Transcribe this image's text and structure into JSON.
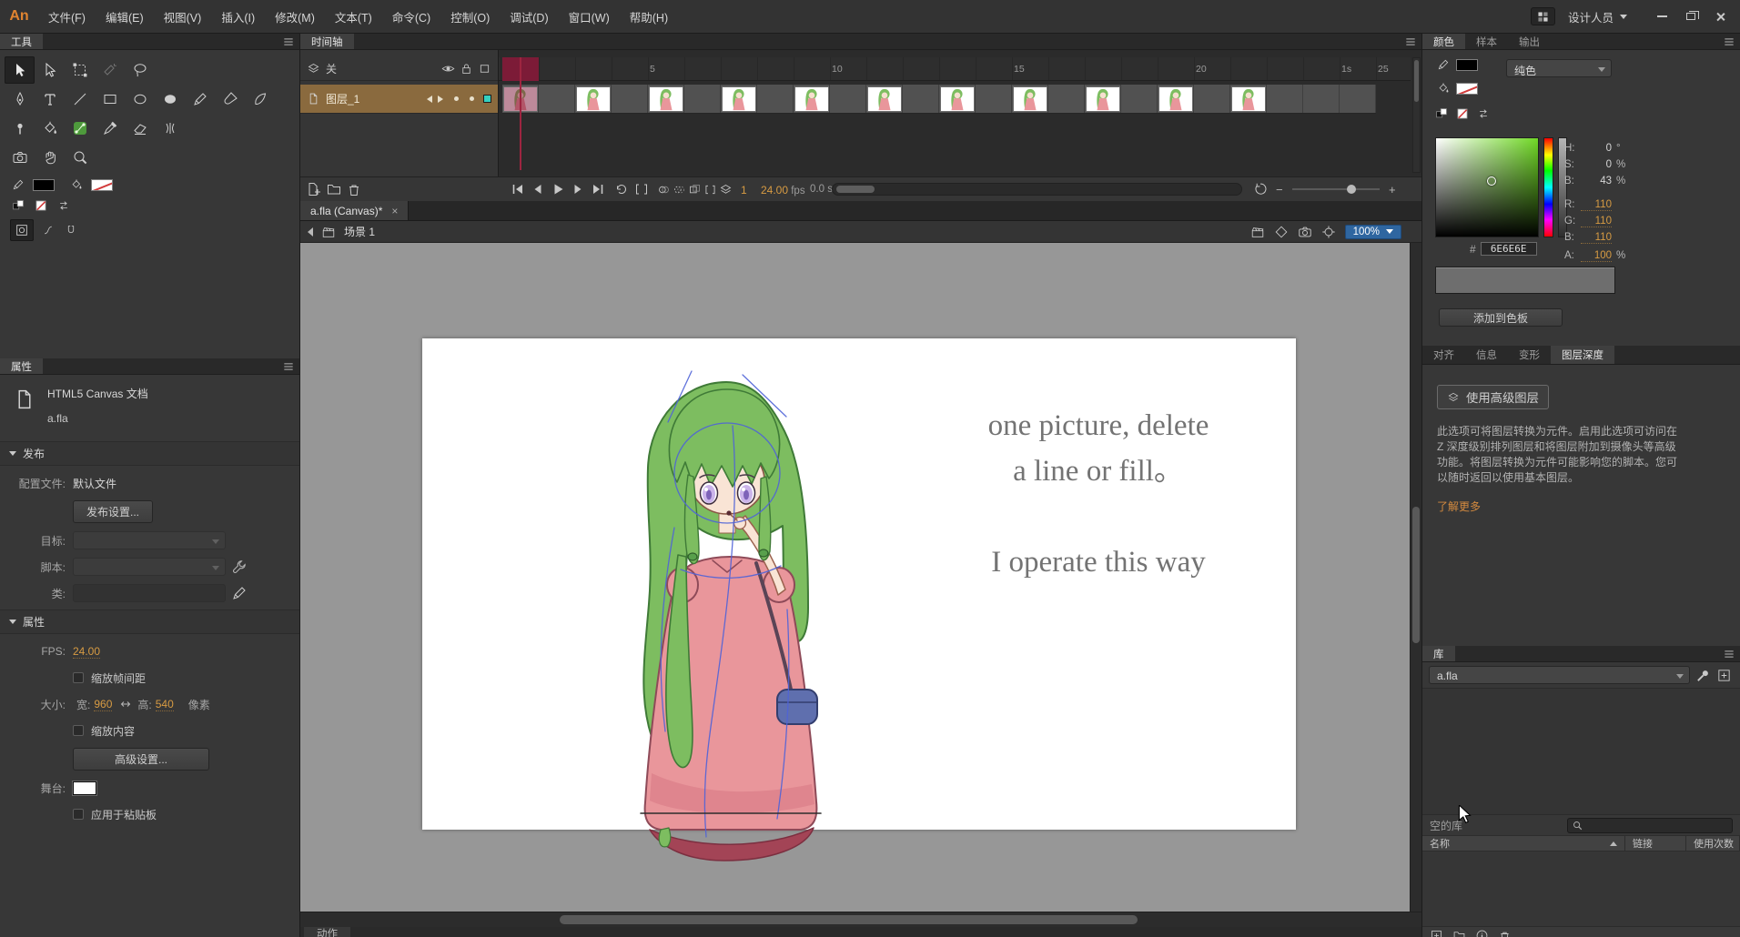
{
  "menu": {
    "logo": "An",
    "items": [
      "文件(F)",
      "编辑(E)",
      "视图(V)",
      "插入(I)",
      "修改(M)",
      "文本(T)",
      "命令(C)",
      "控制(O)",
      "调试(D)",
      "窗口(W)",
      "帮助(H)"
    ],
    "workspace": "设计人员"
  },
  "tools": {
    "title": "工具",
    "selected": "selection",
    "dimmed": [
      "magic-wand"
    ],
    "rows": [
      [
        "selection",
        "subselection",
        "free-transform",
        "magic-wand",
        "lasso"
      ],
      [
        "pen",
        "text",
        "line",
        "rectangle",
        "oval",
        "oval-filled",
        "pencil",
        "brush",
        "fluid-brush"
      ],
      [
        "asset-warp",
        "paint-bucket",
        "bind",
        "eyedropper",
        "eraser",
        "width"
      ],
      [
        "camera",
        "hand",
        "zoom"
      ]
    ]
  },
  "properties": {
    "title": "属性",
    "doc_type": "HTML5 Canvas 文档",
    "doc_name": "a.fla",
    "publish": {
      "section": "发布",
      "profile_label": "配置文件:",
      "profile_value": "默认文件",
      "publish_settings": "发布设置...",
      "target_label": "目标:",
      "script_label": "脚本:",
      "class_label": "类:"
    },
    "props": {
      "section": "属性",
      "fps_label": "FPS:",
      "fps_value": "24.00",
      "scale_spans": "缩放帧间距",
      "size_label": "大小:",
      "width_label": "宽:",
      "width_value": "960",
      "height_label": "高:",
      "height_value": "540",
      "px_label": "像素",
      "scale_content": "缩放内容",
      "advanced_settings": "高级设置...",
      "stage_label": "舞台:",
      "apply_pasteboard": "应用于粘贴板"
    }
  },
  "timeline": {
    "title": "时间轴",
    "layer_toggle": "关",
    "layer_name": "图层_1",
    "ruler_numbers": [
      5,
      10,
      15,
      20,
      25
    ],
    "second_marker": "1s",
    "keyframes": [
      1,
      3,
      5,
      7,
      9,
      11,
      13,
      15,
      17,
      19,
      21
    ],
    "current_frame": "1",
    "fps_value": "24.00",
    "fps_unit": "fps",
    "elapsed_value": "0.0",
    "elapsed_unit": "s"
  },
  "document": {
    "tab_label": "a.fla (Canvas)*",
    "close_label": "×"
  },
  "editbar": {
    "scene_label": "场景 1",
    "zoom_value": "100%"
  },
  "stage": {
    "text_line1": "one picture, delete",
    "text_line2": "a line or fill。",
    "text_line3": "I operate this way"
  },
  "color_panel": {
    "tabs": [
      "颜色",
      "样本",
      "输出"
    ],
    "active_tab": 0,
    "type_value": "纯色",
    "hsb": [
      {
        "label": "H:",
        "value": "0",
        "unit": "°"
      },
      {
        "label": "S:",
        "value": "0",
        "unit": "%"
      },
      {
        "label": "B:",
        "value": "43",
        "unit": "%"
      }
    ],
    "rgb": [
      {
        "label": "R:",
        "value": "110"
      },
      {
        "label": "G:",
        "value": "110"
      },
      {
        "label": "B:",
        "value": "110"
      }
    ],
    "alpha": {
      "label": "A:",
      "value": "100",
      "unit": "%"
    },
    "hex_label": "#",
    "hex_value": "6E6E6E",
    "current_color": "#6E6E6E",
    "add_swatch_label": "添加到色板"
  },
  "tabs2": {
    "items": [
      "对齐",
      "信息",
      "变形",
      "图层深度"
    ],
    "active_index": 3
  },
  "layer_depth": {
    "button_label": "使用高级图层",
    "description": "此选项可将图层转换为元件。启用此选项可访问在 Z 深度级别排列图层和将图层附加到摄像头等高级功能。将图层转换为元件可能影响您的脚本。您可以随时返回以使用基本图层。",
    "learn_more": "了解更多"
  },
  "library": {
    "title": "库",
    "doc_value": "a.fla",
    "empty_label": "空的库",
    "columns": [
      "名称",
      "链接",
      "使用次数"
    ]
  },
  "statusbar": {
    "actions_tab": "动作"
  }
}
